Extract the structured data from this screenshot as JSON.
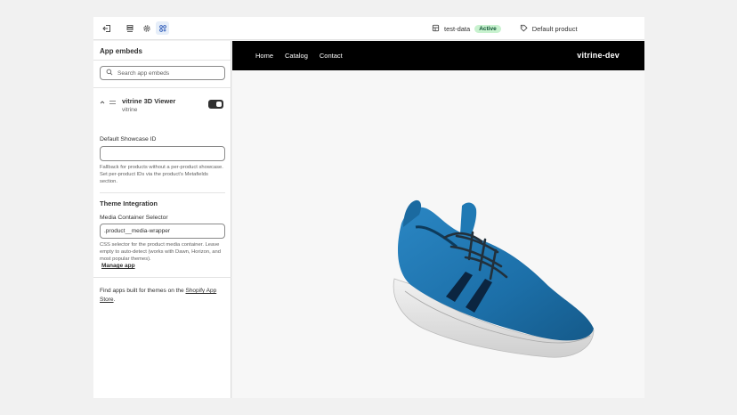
{
  "topbar": {
    "exit_icon": "exit-icon",
    "sections_icon": "sections-icon",
    "settings_icon": "gear-icon",
    "apps_icon": "apps-icon",
    "theme_name": "test-data",
    "theme_status": "Active",
    "template_name": "Default product"
  },
  "sidebar": {
    "title": "App embeds",
    "search_placeholder": "Search app embeds",
    "embed": {
      "name": "vitrine 3D Viewer",
      "provider": "vitrine",
      "enabled": true
    },
    "showcase_label": "Default Showcase ID",
    "showcase_value": "",
    "showcase_help": "Fallback for products without a per-product showcase. Set per-product IDs via the product's Metafields section.",
    "theme_section_title": "Theme Integration",
    "selector_label": "Media Container Selector",
    "selector_value": ".product__media-wrapper",
    "selector_help": "CSS selector for the product media container. Leave empty to auto-detect (works with Dawn, Horizon, and most popular themes).",
    "manage_link": "Manage app",
    "footer_prefix": "Find apps built for themes on the ",
    "footer_link": "Shopify App Store",
    "footer_suffix": "."
  },
  "preview": {
    "nav": [
      "Home",
      "Catalog",
      "Contact"
    ],
    "brand": "vitrine-dev"
  },
  "colors": {
    "active_badge_bg": "#c8f2cf",
    "active_badge_text": "#0c5132",
    "store_nav_bg": "#000000",
    "shoe_blue": "#1f73ad"
  }
}
